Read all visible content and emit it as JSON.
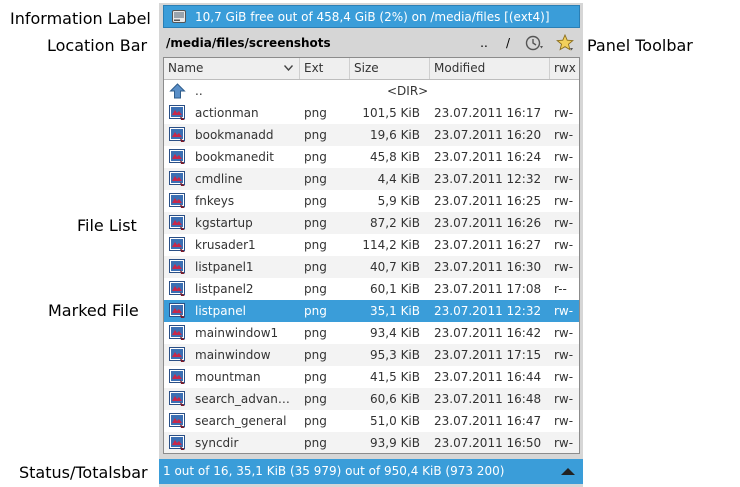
{
  "callouts": {
    "information_label": "Information Label",
    "location_bar": "Location Bar",
    "panel_toolbar": "Panel Toolbar",
    "file_list": "File List",
    "marked_file": "Marked File",
    "status_totalsbar": "Status/Totalsbar"
  },
  "info_bar": {
    "text": "10,7 GiB free out of 458,4 GiB (2%) on /media/files [(ext4)]",
    "icon": "drive-icon"
  },
  "location_bar": {
    "path": "/media/files/screenshots"
  },
  "toolbar": {
    "parent_label": "..",
    "root_label": "/",
    "history_icon": "history-icon",
    "bookmark_icon": "bookmark-star-icon"
  },
  "columns": {
    "name": "Name",
    "ext": "Ext",
    "size": "Size",
    "modified": "Modified",
    "rwx": "rwx"
  },
  "updir": {
    "name": "..",
    "size": "<DIR>"
  },
  "files": [
    {
      "name": "actionman",
      "ext": "png",
      "size": "101,5 KiB",
      "modified": "23.07.2011 16:17",
      "rwx": "rw-"
    },
    {
      "name": "bookmanadd",
      "ext": "png",
      "size": "19,6 KiB",
      "modified": "23.07.2011 16:20",
      "rwx": "rw-"
    },
    {
      "name": "bookmanedit",
      "ext": "png",
      "size": "45,8 KiB",
      "modified": "23.07.2011 16:24",
      "rwx": "rw-"
    },
    {
      "name": "cmdline",
      "ext": "png",
      "size": "4,4 KiB",
      "modified": "23.07.2011 12:32",
      "rwx": "rw-"
    },
    {
      "name": "fnkeys",
      "ext": "png",
      "size": "5,9 KiB",
      "modified": "23.07.2011 16:25",
      "rwx": "rw-"
    },
    {
      "name": "kgstartup",
      "ext": "png",
      "size": "87,2 KiB",
      "modified": "23.07.2011 16:26",
      "rwx": "rw-"
    },
    {
      "name": "krusader1",
      "ext": "png",
      "size": "114,2 KiB",
      "modified": "23.07.2011 16:27",
      "rwx": "rw-"
    },
    {
      "name": "listpanel1",
      "ext": "png",
      "size": "40,7 KiB",
      "modified": "23.07.2011 16:30",
      "rwx": "rw-"
    },
    {
      "name": "listpanel2",
      "ext": "png",
      "size": "60,1 KiB",
      "modified": "23.07.2011 17:08",
      "rwx": "r--"
    },
    {
      "name": "listpanel",
      "ext": "png",
      "size": "35,1 KiB",
      "modified": "23.07.2011 12:32",
      "rwx": "rw-",
      "marked": true
    },
    {
      "name": "mainwindow1",
      "ext": "png",
      "size": "93,4 KiB",
      "modified": "23.07.2011 16:42",
      "rwx": "rw-"
    },
    {
      "name": "mainwindow",
      "ext": "png",
      "size": "95,3 KiB",
      "modified": "23.07.2011 17:15",
      "rwx": "rw-"
    },
    {
      "name": "mountman",
      "ext": "png",
      "size": "41,5 KiB",
      "modified": "23.07.2011 16:44",
      "rwx": "rw-"
    },
    {
      "name": "search_advan…",
      "ext": "png",
      "size": "60,6 KiB",
      "modified": "23.07.2011 16:48",
      "rwx": "rw-"
    },
    {
      "name": "search_general",
      "ext": "png",
      "size": "51,0 KiB",
      "modified": "23.07.2011 16:47",
      "rwx": "rw-"
    },
    {
      "name": "syncdir",
      "ext": "png",
      "size": "93,9 KiB",
      "modified": "23.07.2011 16:50",
      "rwx": "rw-"
    }
  ],
  "status_bar": {
    "text": "1 out of 16, 35,1 KiB (35 979) out of 950,4 KiB (973 200)"
  },
  "colors": {
    "accent": "#3a9dd9"
  }
}
